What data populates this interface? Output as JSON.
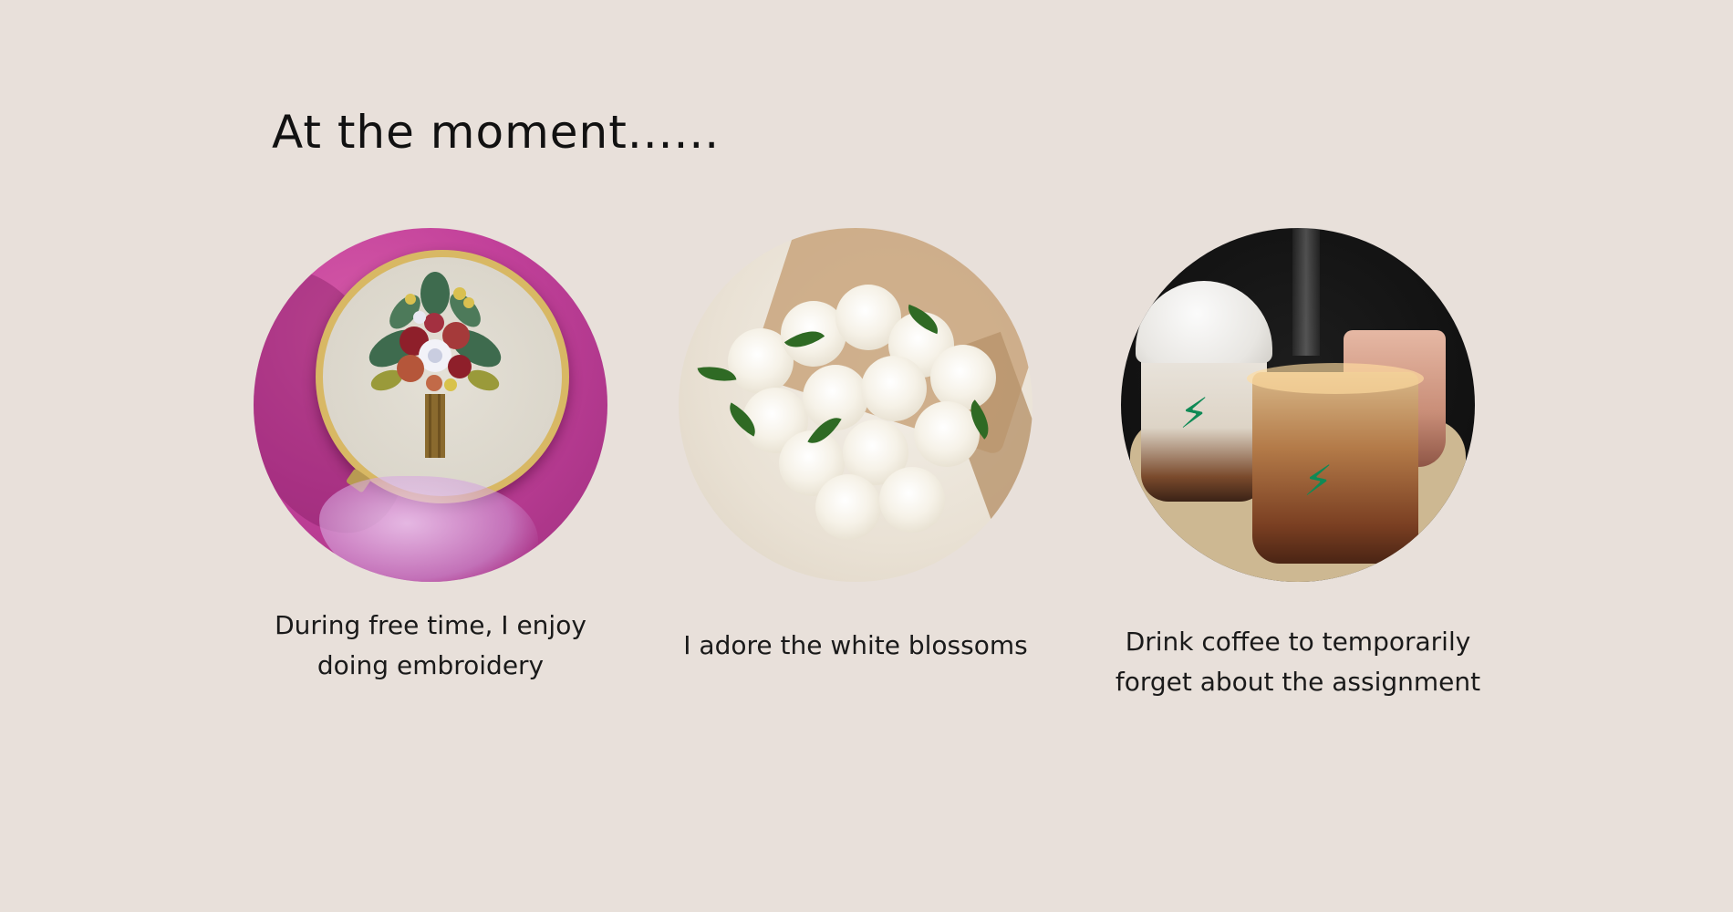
{
  "page": {
    "title": "At the moment......"
  },
  "cards": [
    {
      "caption_line1": "During free time, I enjoy",
      "caption_line2": "doing embroidery",
      "image_icon": "embroidery-hoop-photo"
    },
    {
      "caption_line1": "I adore the white blossoms",
      "caption_line2": "",
      "image_icon": "white-flowers-photo"
    },
    {
      "caption_line1": "Drink coffee to temporarily",
      "caption_line2": "forget about the assignment",
      "image_icon": "coffee-cups-photo"
    }
  ],
  "colors": {
    "background": "#e8e0da",
    "text": "#111111"
  }
}
